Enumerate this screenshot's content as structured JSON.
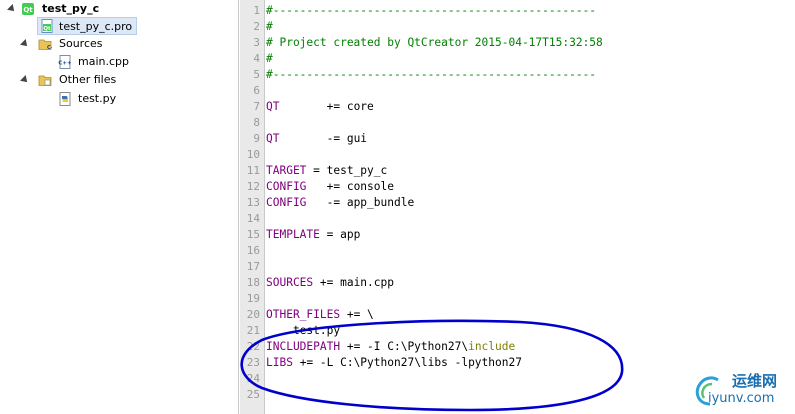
{
  "tree": {
    "project_name": "test_py_c",
    "pro_file": "test_py_c.pro",
    "sources_label": "Sources",
    "source_file": "main.cpp",
    "other_files_label": "Other files",
    "other_file": "test.py",
    "icons": {
      "project": "qt-project-icon",
      "pro_file": "qt-pro-file-icon",
      "folder": "folder-icon",
      "cpp_file": "cpp-file-icon",
      "python_file": "python-file-icon"
    }
  },
  "editor": {
    "line_numbers": [
      "1",
      "2",
      "3",
      "4",
      "5",
      "6",
      "7",
      "8",
      "9",
      "10",
      "11",
      "12",
      "13",
      "14",
      "15",
      "16",
      "17",
      "18",
      "19",
      "20",
      "21",
      "22",
      "23",
      "24",
      "25"
    ],
    "lines": {
      "l1": "#------------------------------------------------",
      "l2": "#",
      "l3": "# Project created by QtCreator 2015-04-17T15:32:58",
      "l4": "#",
      "l5": "#------------------------------------------------",
      "l7a": "QT",
      "l7b": "       += core",
      "l9a": "QT",
      "l9b": "       -= gui",
      "l11a": "TARGET",
      "l11b": " = test_py_c",
      "l12a": "CONFIG",
      "l12b": "   += console",
      "l13a": "CONFIG",
      "l13b": "   -= app_bundle",
      "l15a": "TEMPLATE",
      "l15b": " = app",
      "l18a": "SOURCES",
      "l18b": " += main.cpp",
      "l20a": "OTHER_FILES",
      "l20b": " += \\",
      "l21": "    test.py",
      "l22a": "INCLUDEPATH",
      "l22b": " += -I C:\\Python27\\",
      "l22c": "include",
      "l23a": "LIBS",
      "l23b": " += -L C:\\Python27\\libs -lpython27"
    }
  },
  "colors": {
    "comment": "#008000",
    "keyword": "#800080",
    "include": "#808000",
    "annotation": "#0000cc",
    "watermark": "#1a6fb0"
  },
  "watermark": {
    "cn": "运维网",
    "url": "iyunv.com"
  }
}
